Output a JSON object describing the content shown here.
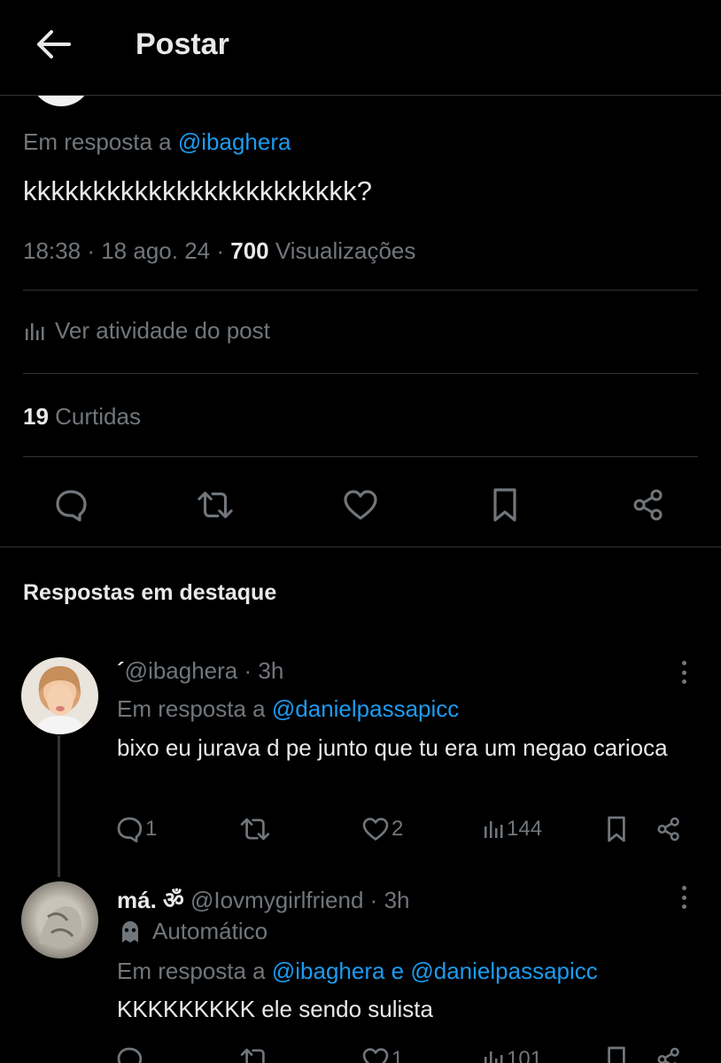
{
  "header": {
    "title": "Postar"
  },
  "post": {
    "reply_to_prefix": "Em resposta a",
    "reply_to_handle": "@ibaghera",
    "text": "kkkkkkkkkkkkkkkkkkkkkkkk?",
    "time": "18:38",
    "date": "18 ago. 24",
    "separator": "·",
    "views_count": "700",
    "views_label": "Visualizações",
    "activity_label": "Ver atividade do post",
    "likes_count": "19",
    "likes_label": "Curtidas"
  },
  "section_title": "Respostas em destaque",
  "replies": [
    {
      "name": "´",
      "handle": "@ibaghera",
      "time": "3h",
      "reply_to_prefix": "Em resposta a",
      "reply_to_handle": "@danielpassapicc",
      "text": "bixo eu jurava d pe junto que tu era um negao carioca",
      "replies_count": "1",
      "likes_count": "2",
      "views_count": "144"
    },
    {
      "name": "má. ॐ",
      "handle": "@Iovmygirlfriend",
      "time": "3h",
      "label": "Automático",
      "reply_to_prefix": "Em resposta a",
      "reply_to_handle": "@ibaghera e @danielpassapicc",
      "text": "KKKKKKKKK ele sendo sulista",
      "likes_count": "1",
      "views_count": "101"
    }
  ],
  "colors": {
    "background": "#000000",
    "text": "#e7e9ea",
    "muted": "#71767b",
    "link": "#1d9bf0",
    "divider": "#2f3336"
  }
}
